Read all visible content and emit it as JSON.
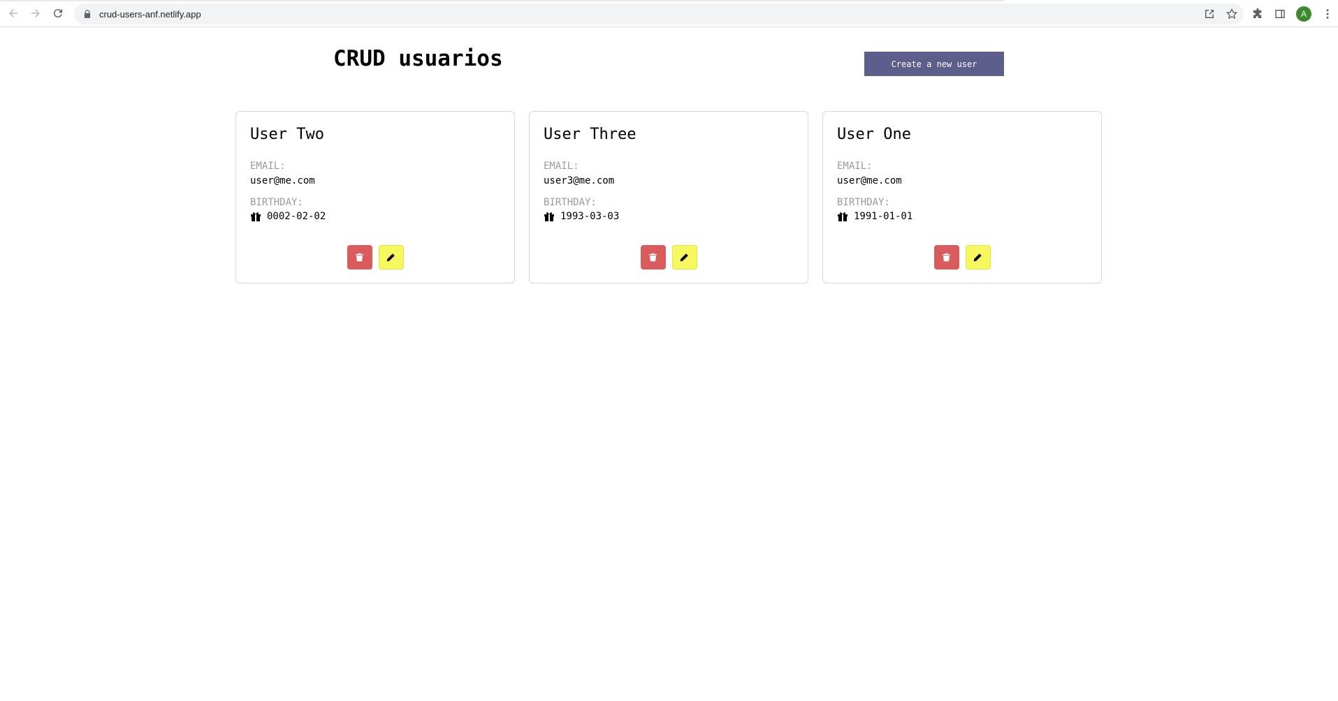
{
  "browser": {
    "url": "crud-users-anf.netlify.app",
    "profile_initial": "A"
  },
  "page": {
    "title": "CRUD usuarios",
    "create_button_label": "Create a new user"
  },
  "labels": {
    "email": "EMAIL:",
    "birthday": "BIRTHDAY:"
  },
  "users": [
    {
      "name": "User Two",
      "email": "user@me.com",
      "birthday": "0002-02-02"
    },
    {
      "name": "User Three",
      "email": "user3@me.com",
      "birthday": "1993-03-03"
    },
    {
      "name": "User One",
      "email": "user@me.com",
      "birthday": "1991-01-01"
    }
  ],
  "colors": {
    "create_button": "#5d5e8c",
    "delete_button": "#d95b5b",
    "edit_button": "#f7f75e",
    "avatar": "#3c8a2e"
  },
  "icons": {
    "back": "arrow-left-icon",
    "forward": "arrow-right-icon",
    "reload": "reload-icon",
    "lock": "lock-icon",
    "share": "share-icon",
    "bookmark": "star-icon",
    "extensions": "puzzle-icon",
    "side_panel": "side-panel-icon",
    "menu": "kebab-menu-icon",
    "gift": "gift-icon",
    "delete": "trash-icon",
    "edit": "pencil-icon"
  }
}
